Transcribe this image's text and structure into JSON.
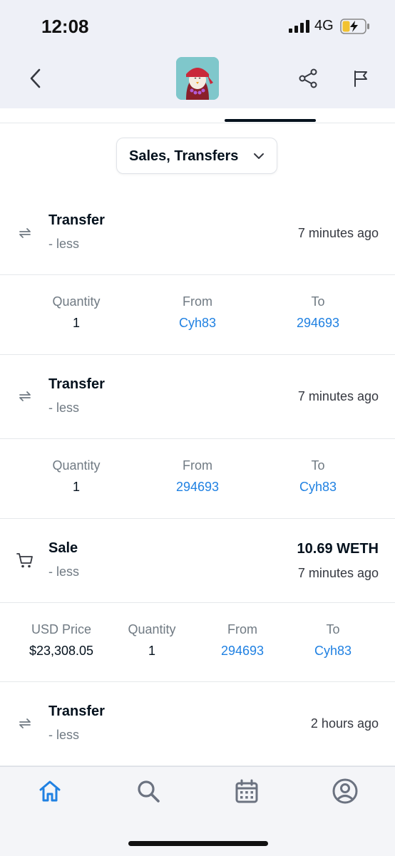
{
  "status_bar": {
    "time": "12:08",
    "network": "4G"
  },
  "header": {
    "back_icon": "chevron-left-icon",
    "share_icon": "share-icon",
    "flag_icon": "flag-icon"
  },
  "filter": {
    "label": "Sales, Transfers",
    "icon": "chevron-down-icon"
  },
  "colors": {
    "link": "#2081e2",
    "accent": "#2081e2",
    "text_primary": "#04111d",
    "text_secondary": "#707a83"
  },
  "events": [
    {
      "type": "Transfer",
      "sub": "- less",
      "time": "7 minutes ago",
      "icon": "transfer-arrows-icon",
      "details": {
        "quantity_label": "Quantity",
        "quantity": "1",
        "from_label": "From",
        "from": "Cyh83",
        "to_label": "To",
        "to": "294693"
      }
    },
    {
      "type": "Transfer",
      "sub": "- less",
      "time": "7 minutes ago",
      "icon": "transfer-arrows-icon",
      "details": {
        "quantity_label": "Quantity",
        "quantity": "1",
        "from_label": "From",
        "from": "294693",
        "to_label": "To",
        "to": "Cyh83"
      }
    },
    {
      "type": "Sale",
      "sub": "- less",
      "price": "10.69 WETH",
      "time": "7 minutes ago",
      "icon": "cart-icon",
      "details": {
        "usd_label": "USD Price",
        "usd": "$23,308.05",
        "quantity_label": "Quantity",
        "quantity": "1",
        "from_label": "From",
        "from": "294693",
        "to_label": "To",
        "to": "Cyh83"
      }
    },
    {
      "type": "Transfer",
      "sub": "- less",
      "time": "2 hours ago",
      "icon": "transfer-arrows-icon"
    }
  ],
  "bottom_nav": [
    {
      "name": "home",
      "icon": "home-icon",
      "active": true
    },
    {
      "name": "search",
      "icon": "search-icon",
      "active": false
    },
    {
      "name": "calendar",
      "icon": "calendar-icon",
      "active": false
    },
    {
      "name": "profile",
      "icon": "profile-icon",
      "active": false
    }
  ]
}
